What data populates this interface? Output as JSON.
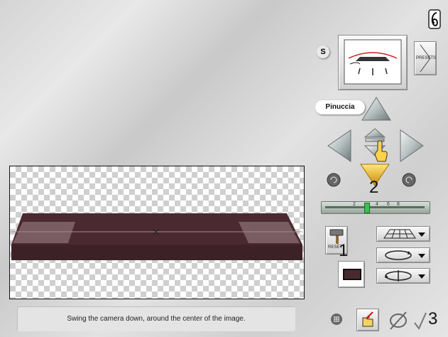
{
  "app": {
    "name": "Pinuccia"
  },
  "status": {
    "text": "Swing the camera down, around the center of the image."
  },
  "preset": {
    "label": "PRESETS"
  },
  "reset": {
    "label": "RESET"
  },
  "steps": {
    "one": "1",
    "two": "2",
    "three": "3"
  },
  "slider": {
    "ticks": [
      "2",
      "4",
      "6",
      "8"
    ]
  },
  "icons": {
    "top_right": "page-curl-icon",
    "s_button": "s-icon",
    "grid": "grid-icon",
    "export": "export-icon",
    "no": "no-icon",
    "ok": "checkmark-icon"
  },
  "colors": {
    "plane": "#4a2a30",
    "highlight": "#f5c400"
  },
  "labels": {
    "s": "S"
  }
}
